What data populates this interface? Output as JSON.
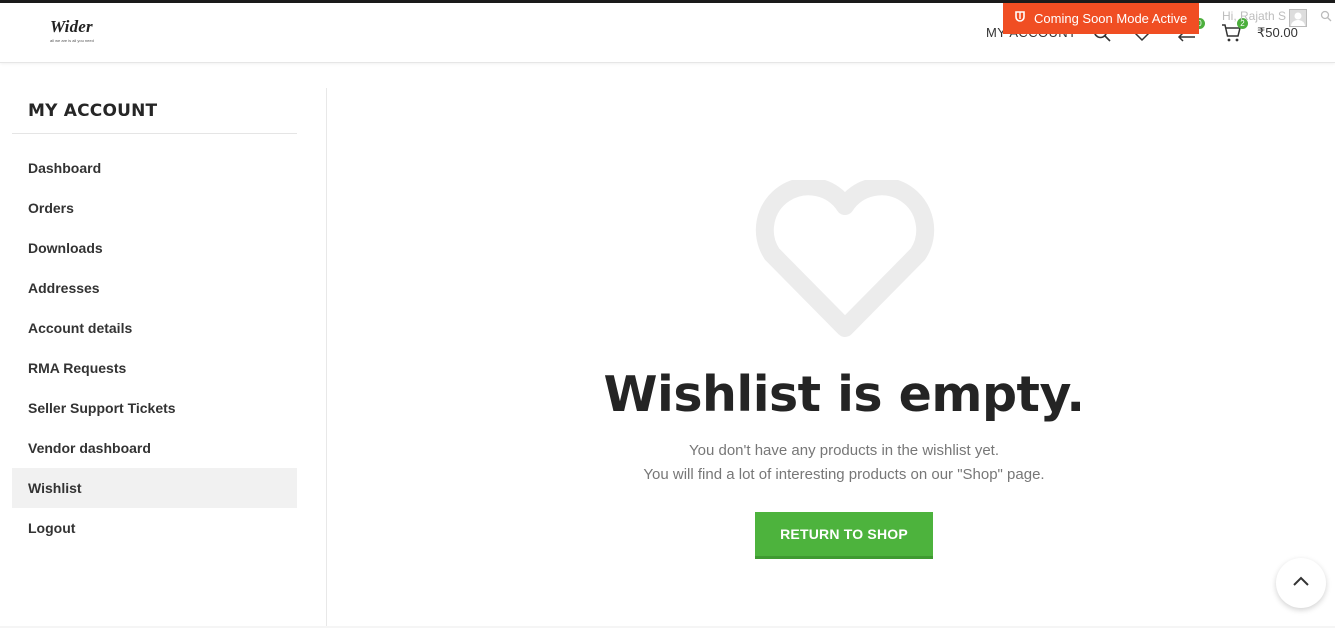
{
  "header": {
    "logo_text": "Wider",
    "logo_tagline": "all we are is all you need",
    "nav_my_account": "MY ACCOUNT",
    "wishlist_count": "0",
    "compare_count": "0",
    "cart_count": "2",
    "cart_total": "₹50.00",
    "icons": [
      "search-icon",
      "heart-icon",
      "compare-icon",
      "cart-icon"
    ]
  },
  "admin_bar": {
    "coming_soon_label": "Coming Soon Mode Active",
    "user_name": "Hi, Rajath S",
    "accent_color": "#f04e23"
  },
  "sidebar": {
    "title": "MY ACCOUNT",
    "items": [
      {
        "label": "Dashboard"
      },
      {
        "label": "Orders"
      },
      {
        "label": "Downloads"
      },
      {
        "label": "Addresses"
      },
      {
        "label": "Account details"
      },
      {
        "label": "RMA Requests"
      },
      {
        "label": "Seller Support Tickets"
      },
      {
        "label": "Vendor dashboard"
      },
      {
        "label": "Wishlist",
        "active": true
      },
      {
        "label": "Logout"
      }
    ]
  },
  "main": {
    "empty_title": "Wishlist is empty.",
    "empty_line_1": "You don't have any products in the wishlist yet.",
    "empty_line_2": "You will find a lot of interesting products on our \"Shop\" page.",
    "return_button": "RETURN TO SHOP",
    "button_color": "#4db33d",
    "empty_icon": "heart-outline-icon"
  },
  "scroll_top_icon": "chevron-up-icon"
}
